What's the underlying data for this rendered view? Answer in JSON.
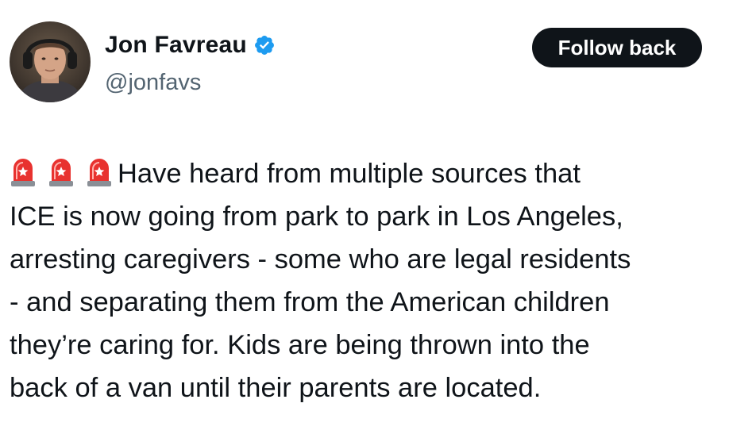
{
  "author": {
    "display_name": "Jon Favreau",
    "handle": "@jonfavs",
    "avatar_icon": "profile-photo",
    "verified_icon": "verified-badge-icon",
    "verified_color": "#1d9bf0"
  },
  "actions": {
    "follow_label": "Follow back"
  },
  "tweet": {
    "leading_icons": [
      "police-siren-icon",
      "police-siren-icon",
      "police-siren-icon"
    ],
    "lines": [
      "Have heard from multiple sources that",
      "ICE is now going from park to park in Los Angeles,",
      "arresting caregivers - some who are legal residents",
      "- and separating them from the American children",
      "they’re caring for. Kids are being thrown into the",
      "back of a van until their parents are located."
    ]
  },
  "colors": {
    "text": "#0f1419",
    "secondary_text": "#536471",
    "button_bg": "#0f1419",
    "button_text": "#ffffff"
  }
}
